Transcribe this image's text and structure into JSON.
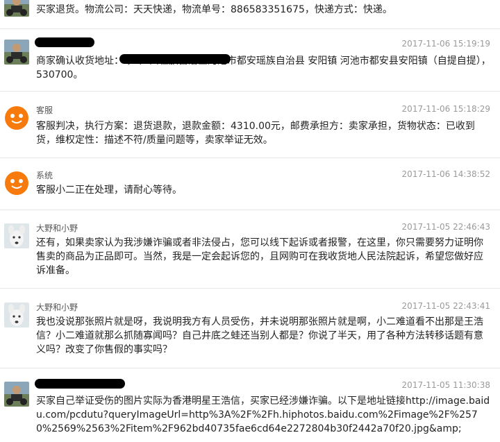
{
  "messages": [
    {
      "name": "",
      "time": "",
      "text": "买家退货。物流公司：天天快递，物流单号：886583351675，快递方式：快递。",
      "avatar": "user-photo"
    },
    {
      "name": "",
      "time": "2017-11-06 15:19:19",
      "text": "商家确认收货地址：                                   ，  广西壮族自治区河池市都安瑶族自治县     安阳镇  河池市都安县安阳镇（自提自提），  530700。",
      "avatar": "user-photo"
    },
    {
      "name": "客服",
      "time": "2017-11-06 15:18:29",
      "text": "客服判决，执行方案：退货退款，退款金额：4310.00元，邮费承担方：卖家承担，货物状态：已收到货，维权定性：描述不符/质量问题等，卖家举证无效。",
      "avatar": "orange-mascot"
    },
    {
      "name": "系统",
      "time": "2017-11-06 14:38:52",
      "text": "客服小二正在处理，请耐心等待。",
      "avatar": "orange-mascot"
    },
    {
      "name": "大野和小野",
      "time": "2017-11-05 22:46:43",
      "text": "还有，如果卖家认为我涉嫌诈骗或者非法侵占，您可以线下起诉或者报警，在这里，你只需要努力证明你售卖的商品为正品即可。当然，我是一定会起诉您的，且网购可在我收货地人民法院起诉，希望您做好应诉准备。",
      "avatar": "dog-photo"
    },
    {
      "name": "大野和小野",
      "time": "2017-11-05 22:43:41",
      "text": "我也没说那张照片就是呀，我说明我方有人员受伤，并未说明那张照片就是啊，小二难道看不出那是王浩信？小二难道就那么抓随寡闻吗？自己井底之蛙还当别人都是？你说了半天，用了各种方法转移话题有意义吗？改变了你售假的事实吗？",
      "avatar": "dog-photo"
    },
    {
      "name": "",
      "time": "2017-11-05 11:30:38",
      "text": "      买家自己举证受伤的图片实际为香港明星王浩信，买家已经涉嫌诈骗。以下是地址链接http://image.baidu.com/pcdutu?queryImageUrl=http%3A%2F%2Fh.hiphotos.baidu.com%2Fimage%2F%2570%2569%2563%2Fitem%2F962bd40735fae6cd64e2272804b30f2442a70f20.jpg&amp;",
      "avatar": "user-photo"
    }
  ]
}
